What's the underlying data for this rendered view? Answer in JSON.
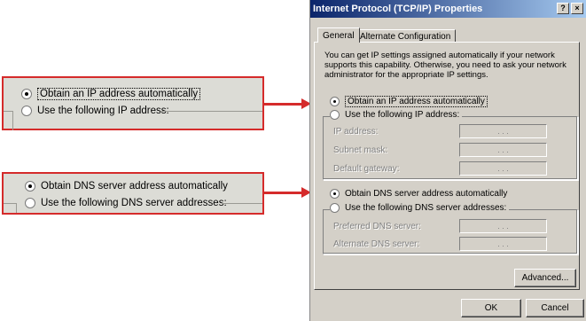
{
  "zoom": {
    "ip_auto_label": "Obtain an IP address automatically",
    "ip_manual_label": "Use the following IP address:",
    "dns_auto_label": "Obtain DNS server address automatically",
    "dns_manual_label": "Use the following DNS server addresses:"
  },
  "dialog": {
    "title": "Internet Protocol (TCP/IP) Properties",
    "help_label": "?",
    "close_label": "×",
    "tabs": [
      {
        "label": "General"
      },
      {
        "label": "Alternate Configuration"
      }
    ],
    "description": "You can get IP settings assigned automatically if your network supports this capability. Otherwise, you need to ask your network administrator for the appropriate IP settings.",
    "ip_auto_label": "Obtain an IP address automatically",
    "ip_manual_label": "Use the following IP address:",
    "ip_fields": [
      {
        "label": "IP address:",
        "value": ". . ."
      },
      {
        "label": "Subnet mask:",
        "value": ". . ."
      },
      {
        "label": "Default gateway:",
        "value": ". . ."
      }
    ],
    "dns_auto_label": "Obtain DNS server address automatically",
    "dns_manual_label": "Use the following DNS server addresses:",
    "dns_fields": [
      {
        "label": "Preferred DNS server:",
        "value": ". . ."
      },
      {
        "label": "Alternate DNS server:",
        "value": ". . ."
      }
    ],
    "advanced_label": "Advanced...",
    "ok_label": "OK",
    "cancel_label": "Cancel"
  },
  "colors": {
    "highlight_border": "#d52b2b",
    "title_start": "#0a246a",
    "title_end": "#a6caf0",
    "face": "#d4d0c8"
  }
}
